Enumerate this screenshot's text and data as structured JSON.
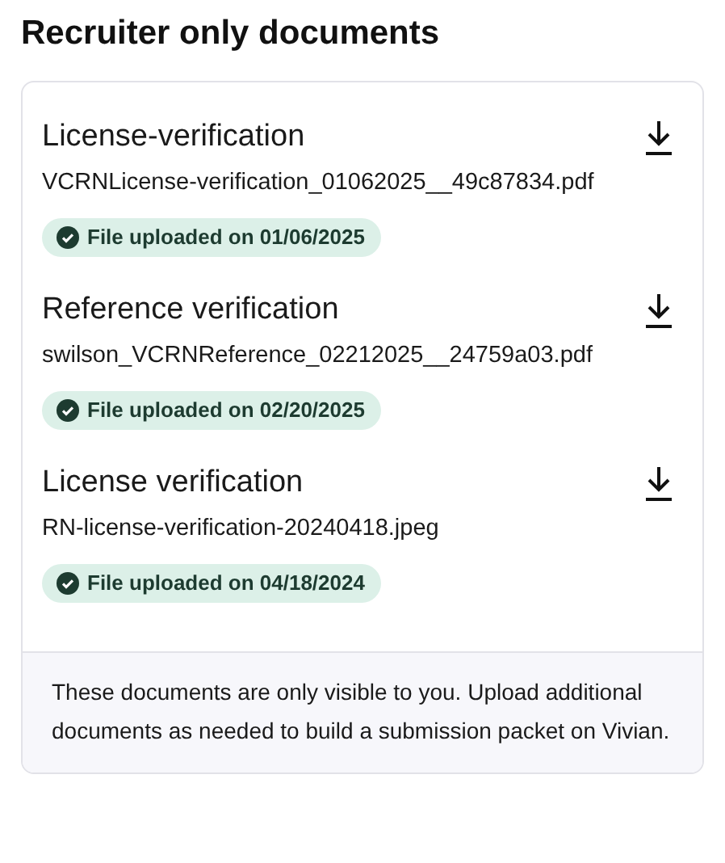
{
  "title": "Recruiter only documents",
  "documents": [
    {
      "name": "License-verification",
      "file": "VCRNLicense-verification_01062025__49c87834.pdf",
      "status": "File uploaded on 01/06/2025"
    },
    {
      "name": "Reference verification",
      "file": "swilson_VCRNReference_02212025__24759a03.pdf",
      "status": "File uploaded on 02/20/2025"
    },
    {
      "name": "License verification",
      "file": "RN-license-verification-20240418.jpeg",
      "status": "File uploaded on 04/18/2024"
    }
  ],
  "footer_note": "These documents are only visible to you. Upload additional documents as needed to build a submission packet on Vivian."
}
